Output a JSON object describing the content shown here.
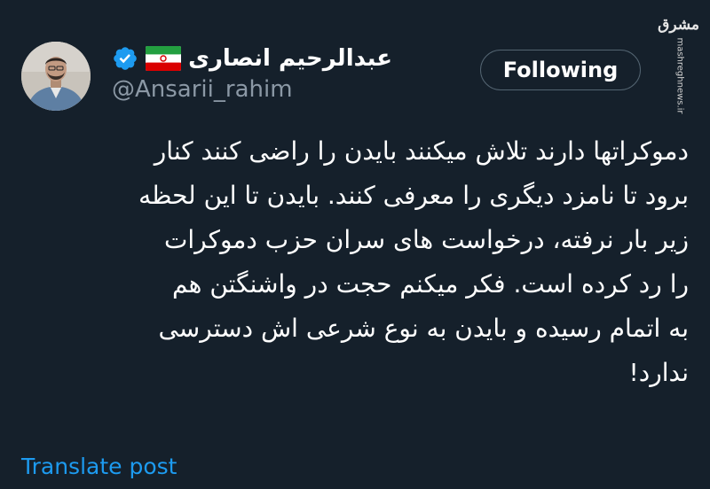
{
  "author": {
    "display_name": "عبدالرحیم انصاری",
    "handle": "@Ansarii_rahim",
    "flag_icon": "iran-flag-icon",
    "verified_icon": "verified-badge-icon"
  },
  "follow_button": {
    "label": "Following"
  },
  "tweet": {
    "lines": [
      "دموکراتها دارند تلاش میکنند بایدن را راضی کنند کنار",
      "برود تا نامزد دیگری را معرفی کنند. بایدن تا این لحظه",
      "زیر بار نرفته، درخواست های سران حزب دموکرات",
      "را رد کرده است. فکر میکنم حجت در واشنگتن هم",
      "به اتمام رسیده و بایدن به نوع شرعی اش دسترسی",
      "ندارد!"
    ]
  },
  "translate_link": {
    "label": "Translate post"
  },
  "watermark": {
    "logo_text": "مشرق",
    "url": "mashreghnews.ir"
  },
  "colors": {
    "background": "#15202b",
    "text": "#ffffff",
    "secondary_text": "#8b98a5",
    "link": "#1d9bf0",
    "verified": "#1d9bf0",
    "button_border": "#536471"
  }
}
